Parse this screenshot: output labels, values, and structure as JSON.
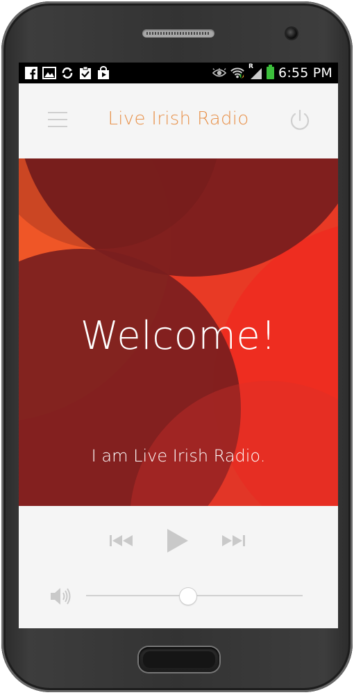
{
  "status_bar": {
    "time": "6:55 PM",
    "left_icons": [
      "facebook-icon",
      "gallery-icon",
      "sync-icon",
      "clipboard-check-icon",
      "play-store-icon"
    ],
    "right_icons": [
      "eye-icon",
      "wifi-icon",
      "signal-icon",
      "battery-icon"
    ],
    "signal_roaming_label": "R",
    "battery_color": "#3cbf3c"
  },
  "header": {
    "title": "Live Irish Radio",
    "menu_icon": "hamburger-menu-icon",
    "power_icon": "power-icon",
    "title_color": "#e8914a"
  },
  "hero": {
    "heading": "Welcome!",
    "subheading": "I am Live Irish Radio.",
    "colors": [
      "#7a1e1e",
      "#e8402a",
      "#f05a28",
      "#e83a25"
    ]
  },
  "player": {
    "prev_icon": "skip-previous-icon",
    "play_icon": "play-icon",
    "next_icon": "skip-next-icon",
    "volume_icon": "volume-icon",
    "volume_level": 0.47
  }
}
